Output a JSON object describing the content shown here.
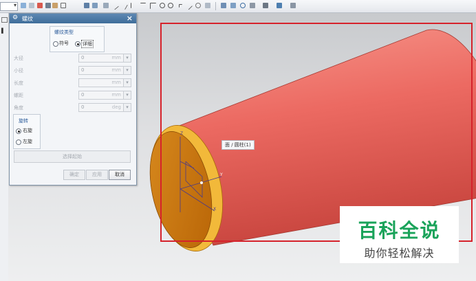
{
  "dialog": {
    "title": "螺纹",
    "thread_type": {
      "group_label": "螺纹类型",
      "options": [
        "符号",
        "详细"
      ],
      "selected": "详细"
    },
    "fields": [
      {
        "label": "大径",
        "value": "0",
        "unit": "mm"
      },
      {
        "label": "小径",
        "value": "0",
        "unit": "mm"
      },
      {
        "label": "长度",
        "value": "",
        "unit": "mm"
      },
      {
        "label": "螺距",
        "value": "0",
        "unit": "mm"
      },
      {
        "label": "角度",
        "value": "0",
        "unit": "deg"
      }
    ],
    "rotation": {
      "group_label": "旋转",
      "options": [
        "右旋",
        "左旋"
      ],
      "selected": "右旋"
    },
    "select_start_label": "选择起始",
    "buttons": {
      "ok": "确定",
      "apply": "应用",
      "cancel": "取消"
    }
  },
  "viewport": {
    "tooltip": "面 / 圆柱(1)",
    "axis_labels": {
      "z": "Z",
      "y": "Y",
      "x": "X"
    }
  },
  "watermark": {
    "title": "百科全说",
    "subtitle": "助你轻松解决"
  },
  "colors": {
    "cylinder_body": "#ec6a62",
    "cylinder_face": "#c8740c",
    "highlight_frame": "#d6222b",
    "dialog_titlebar": "#4f7ba8",
    "watermark_green": "#1aa35a"
  }
}
